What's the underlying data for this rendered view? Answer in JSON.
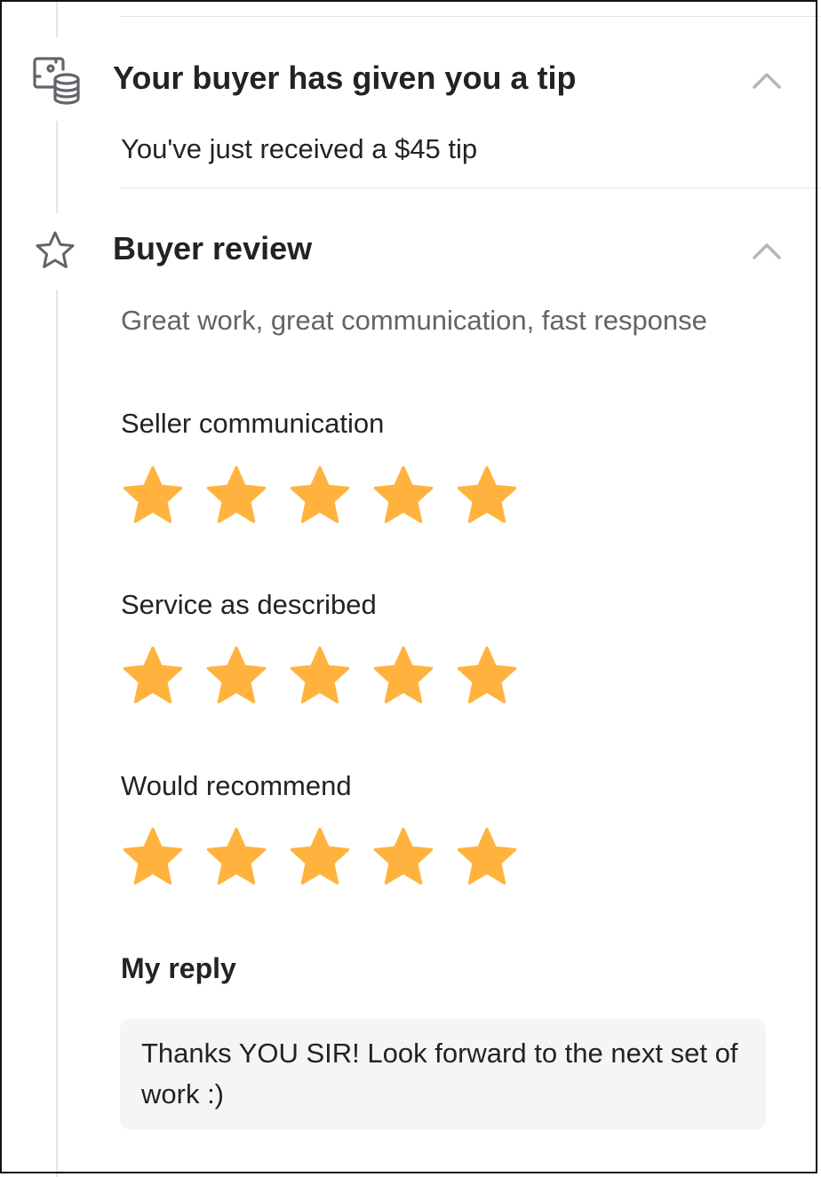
{
  "tip_section": {
    "icon": "tip-coins-icon",
    "title": "Your buyer has given you a tip",
    "message": "You've just received a $45 tip",
    "toggle_icon": "chevron-up-icon"
  },
  "review_section": {
    "icon": "star-outline-icon",
    "title": "Buyer review",
    "review_text": "Great work, great communication, fast response",
    "toggle_icon": "chevron-up-icon",
    "ratings": [
      {
        "label": "Seller communication",
        "stars": 5,
        "max_stars": 5
      },
      {
        "label": "Service as described",
        "stars": 5,
        "max_stars": 5
      },
      {
        "label": "Would recommend",
        "stars": 5,
        "max_stars": 5
      }
    ]
  },
  "reply": {
    "heading": "My reply",
    "text": "Thanks YOU SIR! Look forward to the next set of work :)"
  },
  "colors": {
    "star": "#ffb33e",
    "divider": "#e4e5e7",
    "reply_background": "#f5f5f5",
    "muted_text": "#62646a",
    "text": "#222325"
  }
}
